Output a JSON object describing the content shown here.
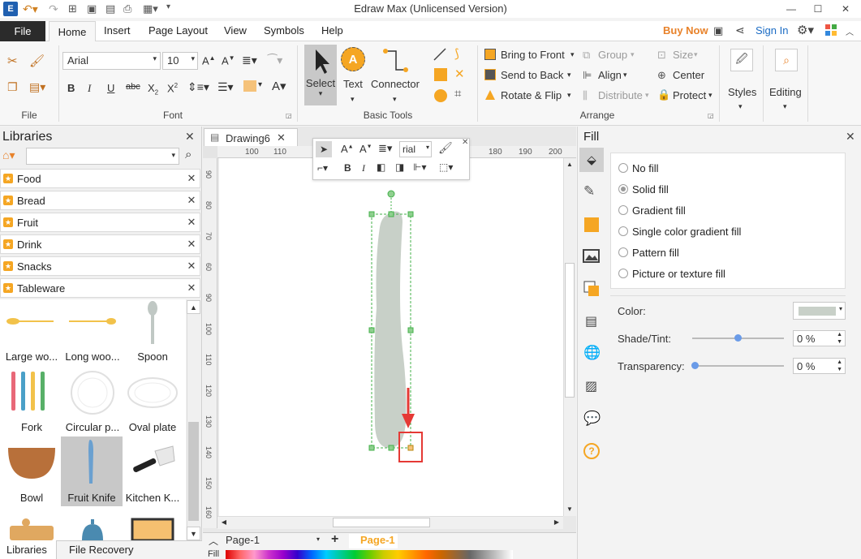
{
  "window": {
    "title": "Edraw Max (Unlicensed Version)",
    "buy_now": "Buy Now",
    "sign_in": "Sign In"
  },
  "menu": {
    "file": "File",
    "tabs": [
      "Home",
      "Insert",
      "Page Layout",
      "View",
      "Symbols",
      "Help"
    ]
  },
  "ribbon": {
    "groups": {
      "file": "File",
      "font": "Font",
      "basic_tools": "Basic Tools",
      "arrange": "Arrange"
    },
    "font": {
      "family": "Arial",
      "size": "10"
    },
    "tools": {
      "select": "Select",
      "text": "Text",
      "connector": "Connector"
    },
    "arrange": {
      "bring_to_front": "Bring to Front",
      "send_to_back": "Send to Back",
      "rotate_flip": "Rotate & Flip",
      "group": "Group",
      "align": "Align",
      "distribute": "Distribute",
      "size": "Size",
      "center": "Center",
      "protect": "Protect"
    },
    "styles": "Styles",
    "editing": "Editing"
  },
  "libraries": {
    "title": "Libraries",
    "categories": [
      "Food",
      "Bread",
      "Fruit",
      "Drink",
      "Snacks",
      "Tableware"
    ],
    "shapes": [
      "Large wo...",
      "Long woo...",
      "Spoon",
      "Fork",
      "Circular p...",
      "Oval plate",
      "Bowl",
      "Fruit Knife",
      "Kitchen K..."
    ]
  },
  "document": {
    "tab": "Drawing6",
    "ruler_h": [
      "100",
      "110",
      "180",
      "190",
      "200"
    ],
    "ruler_v": [
      "90",
      "80",
      "70",
      "60",
      "90",
      "100",
      "110",
      "120",
      "130",
      "140",
      "150",
      "160",
      "60"
    ],
    "mini_toolbar": {
      "font": "rial"
    }
  },
  "fill": {
    "title": "Fill",
    "options": [
      "No fill",
      "Solid fill",
      "Gradient fill",
      "Single color gradient fill",
      "Pattern fill",
      "Picture or texture fill"
    ],
    "selected": "Solid fill",
    "color_label": "Color:",
    "shade_label": "Shade/Tint:",
    "shade_value": "0 %",
    "transparency_label": "Transparency:",
    "transparency_value": "0 %",
    "color_swatch": "#c8d0c8"
  },
  "bottom": {
    "libraries_tab": "Libraries",
    "recovery_tab": "File Recovery",
    "page_select": "Page-1",
    "page_tab": "Page-1",
    "fill_label": "Fill"
  },
  "colors": {
    "accent": "#f5a623",
    "buy_now": "#e8822a",
    "sign_in": "#1a6bc4",
    "selection": "#43b04a",
    "arrow": "#e53935"
  }
}
